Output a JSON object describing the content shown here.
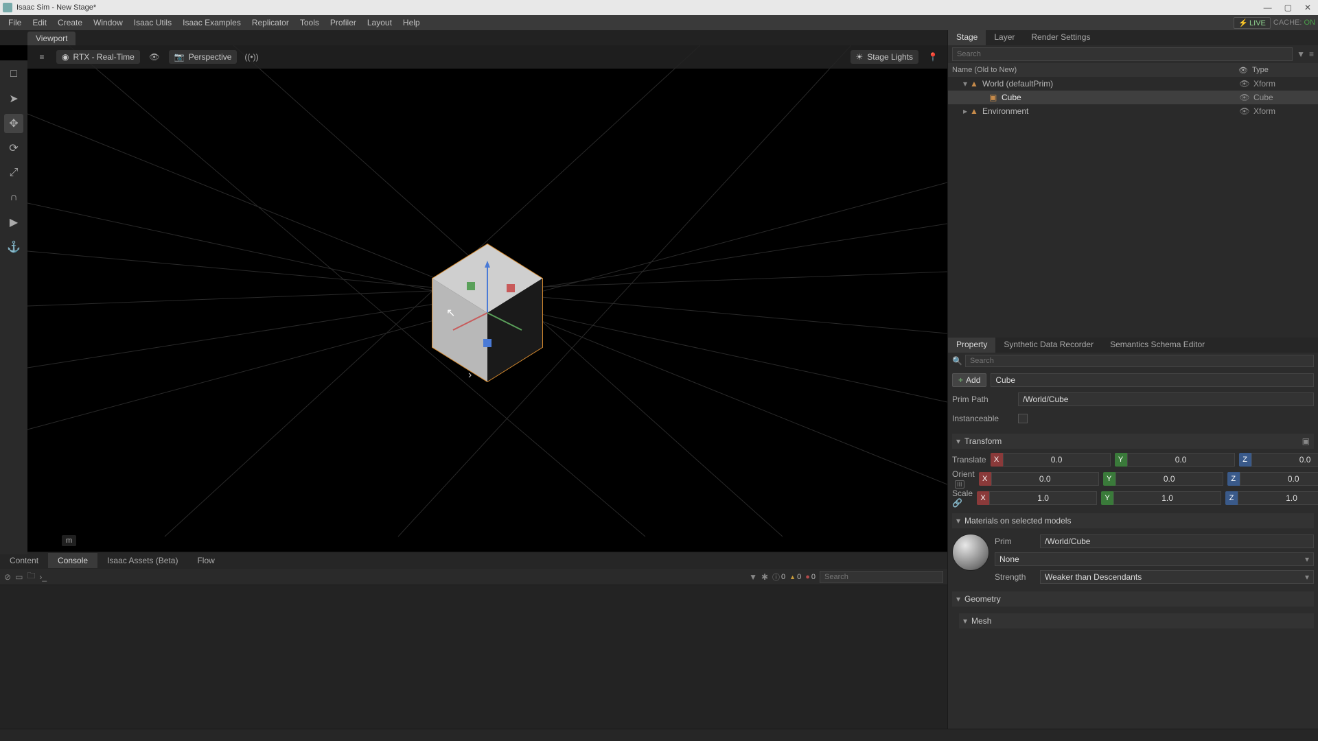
{
  "title": "Isaac Sim   - New Stage*",
  "menubar": [
    "File",
    "Edit",
    "Create",
    "Window",
    "Isaac Utils",
    "Isaac Examples",
    "Replicator",
    "Tools",
    "Profiler",
    "Layout",
    "Help"
  ],
  "live_badge": "LIVE",
  "cache_label": "CACHE:",
  "cache_state": "ON",
  "viewport_tab": "Viewport",
  "vp_toolbar": {
    "renderer": "RTX - Real-Time",
    "camera": "Perspective",
    "lights": "Stage Lights"
  },
  "viewport_unit": "m",
  "bottom_tabs": [
    "Content",
    "Console",
    "Isaac Assets (Beta)",
    "Flow"
  ],
  "bottom_active": 1,
  "console_counts": {
    "info": "0",
    "warn": "0",
    "err": "0"
  },
  "console_search_placeholder": "Search",
  "stage_tabs": [
    "Stage",
    "Layer",
    "Render Settings"
  ],
  "stage_active": 0,
  "stage_search_placeholder": "Search",
  "stage_columns": {
    "name": "Name (Old to New)",
    "type": "Type"
  },
  "stage_tree": [
    {
      "indent": 1,
      "expand": "▾",
      "label": "World (defaultPrim)",
      "type": "Xform",
      "selected": false,
      "icon": "axis"
    },
    {
      "indent": 2,
      "expand": "",
      "label": "Cube",
      "type": "Cube",
      "selected": true,
      "icon": "cube"
    },
    {
      "indent": 1,
      "expand": "▸",
      "label": "Environment",
      "type": "Xform",
      "selected": false,
      "icon": "axis"
    }
  ],
  "prop_tabs": [
    "Property",
    "Synthetic Data Recorder",
    "Semantics Schema Editor"
  ],
  "prop_active": 0,
  "prop_search_placeholder": "Search",
  "add_label": "Add",
  "prim_name": "Cube",
  "prim_path_label": "Prim Path",
  "prim_path": "/World/Cube",
  "instanceable_label": "Instanceable",
  "section_transform": "Transform",
  "translate_label": "Translate",
  "orient_label": "Orient",
  "scale_label": "Scale",
  "translate": {
    "x": "0.0",
    "y": "0.0",
    "z": "0.0"
  },
  "orient": {
    "x": "0.0",
    "y": "0.0",
    "z": "0.0"
  },
  "scale": {
    "x": "1.0",
    "y": "1.0",
    "z": "1.0"
  },
  "section_materials": "Materials on selected models",
  "mat_prim_label": "Prim",
  "mat_prim": "/World/Cube",
  "mat_none": "None",
  "mat_strength_label": "Strength",
  "mat_strength": "Weaker than Descendants",
  "section_geometry": "Geometry",
  "section_mesh": "Mesh"
}
